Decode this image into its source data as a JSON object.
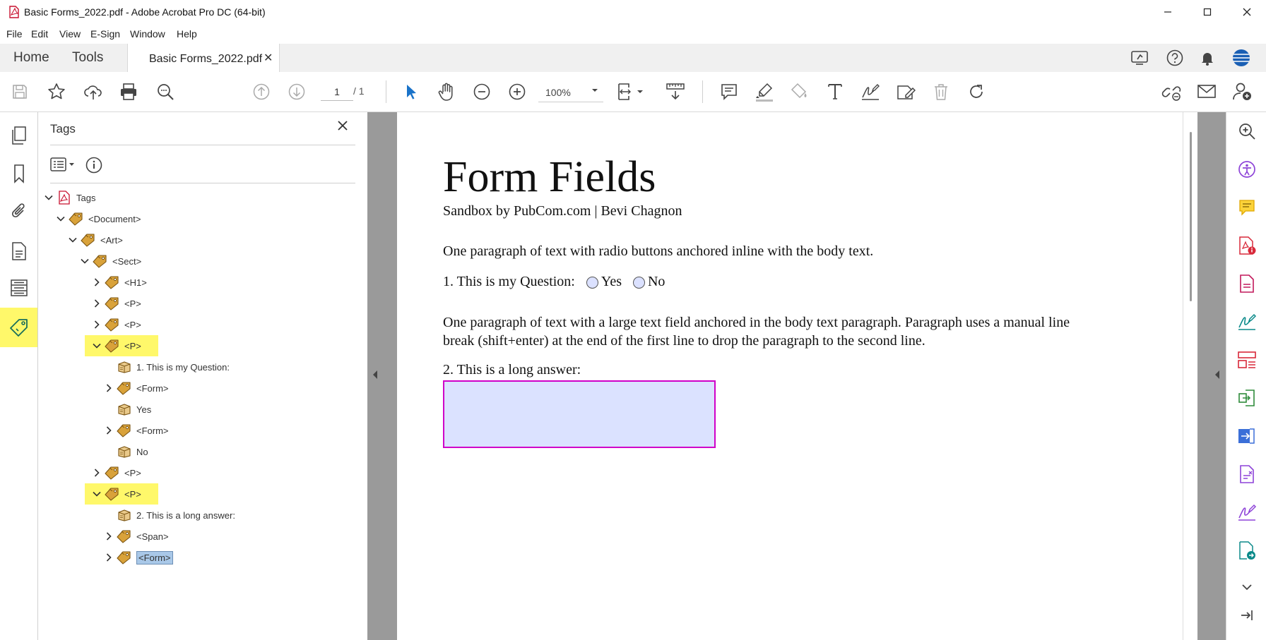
{
  "window": {
    "title": "Basic Forms_2022.pdf - Adobe Acrobat Pro DC (64-bit)"
  },
  "menu": [
    "File",
    "Edit",
    "View",
    "E-Sign",
    "Window",
    "Help"
  ],
  "tabs": {
    "home": "Home",
    "tools": "Tools",
    "document": "Basic Forms_2022.pdf"
  },
  "toolbar": {
    "page_current": "1",
    "page_total": "/ 1",
    "zoom": "100%"
  },
  "tags_panel": {
    "title": "Tags",
    "tree": [
      {
        "label": "Tags",
        "level": 0,
        "expander": "open",
        "icon": "pdf-tags-icon"
      },
      {
        "label": "<Document>",
        "level": 1,
        "expander": "open",
        "icon": "tag-icon"
      },
      {
        "label": "<Art>",
        "level": 2,
        "expander": "open",
        "icon": "tag-icon"
      },
      {
        "label": "<Sect>",
        "level": 3,
        "expander": "open",
        "icon": "tag-icon"
      },
      {
        "label": "<H1>",
        "level": 4,
        "expander": "closed",
        "icon": "tag-icon"
      },
      {
        "label": "<P>",
        "level": 4,
        "expander": "closed",
        "icon": "tag-icon"
      },
      {
        "label": "<P>",
        "level": 4,
        "expander": "closed",
        "icon": "tag-icon"
      },
      {
        "label": "<P>",
        "level": 4,
        "expander": "open",
        "icon": "tag-icon",
        "highlight": true
      },
      {
        "label": "1. This is my Question:",
        "level": 5,
        "expander": "none",
        "icon": "content-icon"
      },
      {
        "label": "<Form>",
        "level": 5,
        "expander": "closed",
        "icon": "tag-icon"
      },
      {
        "label": "Yes",
        "level": 5,
        "expander": "none",
        "icon": "content-icon"
      },
      {
        "label": "<Form>",
        "level": 5,
        "expander": "closed",
        "icon": "tag-icon"
      },
      {
        "label": "No",
        "level": 5,
        "expander": "none",
        "icon": "content-icon"
      },
      {
        "label": "<P>",
        "level": 4,
        "expander": "closed",
        "icon": "tag-icon"
      },
      {
        "label": "<P>",
        "level": 4,
        "expander": "open",
        "icon": "tag-icon",
        "highlight": true
      },
      {
        "label": "2. This is a long answer:",
        "level": 5,
        "expander": "none",
        "icon": "content-icon"
      },
      {
        "label": "<Span>",
        "level": 5,
        "expander": "closed",
        "icon": "tag-icon"
      },
      {
        "label": "<Form>",
        "level": 5,
        "expander": "closed",
        "icon": "tag-icon",
        "selected": true
      }
    ]
  },
  "document": {
    "heading": "Form Fields",
    "subtitle": "Sandbox by PubCom.com | Bevi Chagnon",
    "para1": "One paragraph of text with radio buttons anchored inline with the body text.",
    "question1": "1. This is my Question:",
    "radio_yes": "Yes",
    "radio_no": "No",
    "para2_line1": "One paragraph of text with a large text field anchored in the body text paragraph. Paragraph uses a manual line",
    "para2_line2": "break (shift+enter) at the end of the first line to drop the paragraph to the second line.",
    "question2": "2. This is a long answer:"
  },
  "colors": {
    "highlight": "#fff86a",
    "selection": "#a9c8e8",
    "field_border": "#d000c8",
    "field_fill": "#dbe2ff",
    "accent_blue": "#1a73c9",
    "tool_purple": "#8e44d8",
    "tool_red": "#d8293a"
  }
}
